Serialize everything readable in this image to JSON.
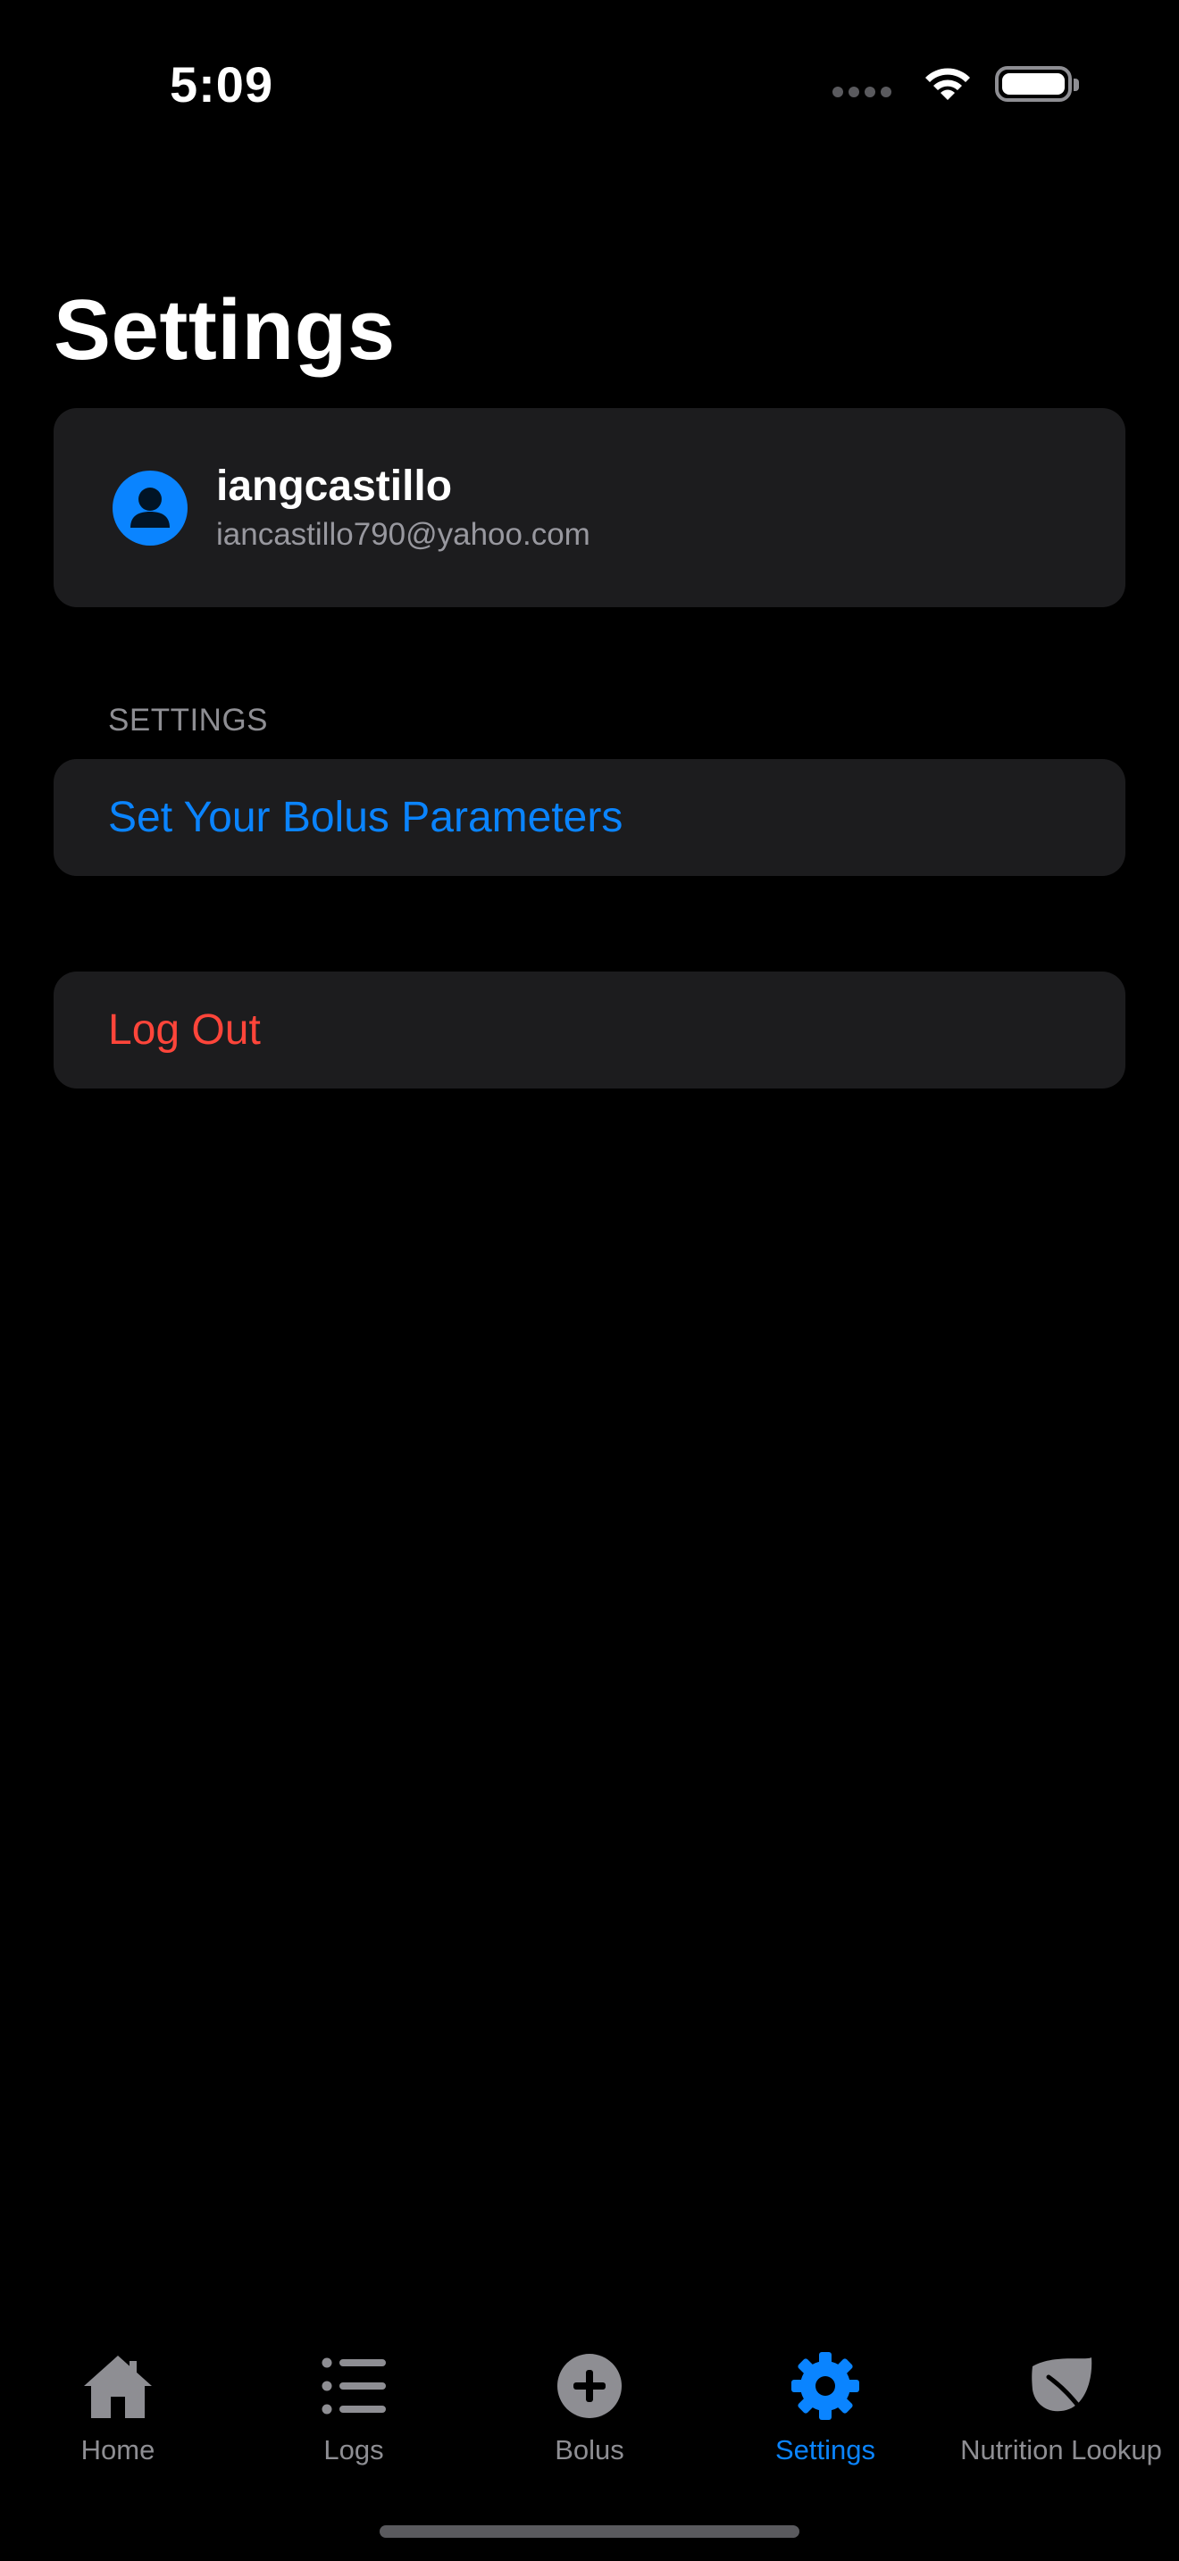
{
  "status_bar": {
    "time": "5:09",
    "signal_icon": "cellular-signal-icon",
    "wifi_icon": "wifi-icon",
    "battery_icon": "battery-full-icon"
  },
  "page": {
    "title": "Settings"
  },
  "profile": {
    "avatar_icon": "person-circle-icon",
    "username": "iangcastillo",
    "email": "iancastillo790@yahoo.com"
  },
  "settings_section": {
    "header": "SETTINGS",
    "items": [
      {
        "label": "Set Your Bolus Parameters"
      }
    ]
  },
  "logout": {
    "label": "Log Out"
  },
  "tab_bar": {
    "items": [
      {
        "label": "Home",
        "icon": "house-icon",
        "active": false
      },
      {
        "label": "Logs",
        "icon": "list-icon",
        "active": false
      },
      {
        "label": "Bolus",
        "icon": "plus-circle-icon",
        "active": false
      },
      {
        "label": "Settings",
        "icon": "gear-icon",
        "active": true
      },
      {
        "label": "Nutrition Lookup",
        "icon": "leaf-icon",
        "active": false
      }
    ]
  },
  "colors": {
    "background": "#000000",
    "card": "#1c1c1e",
    "accent": "#0a84ff",
    "destructive": "#ff453a",
    "secondary_text": "#8e8e93"
  }
}
